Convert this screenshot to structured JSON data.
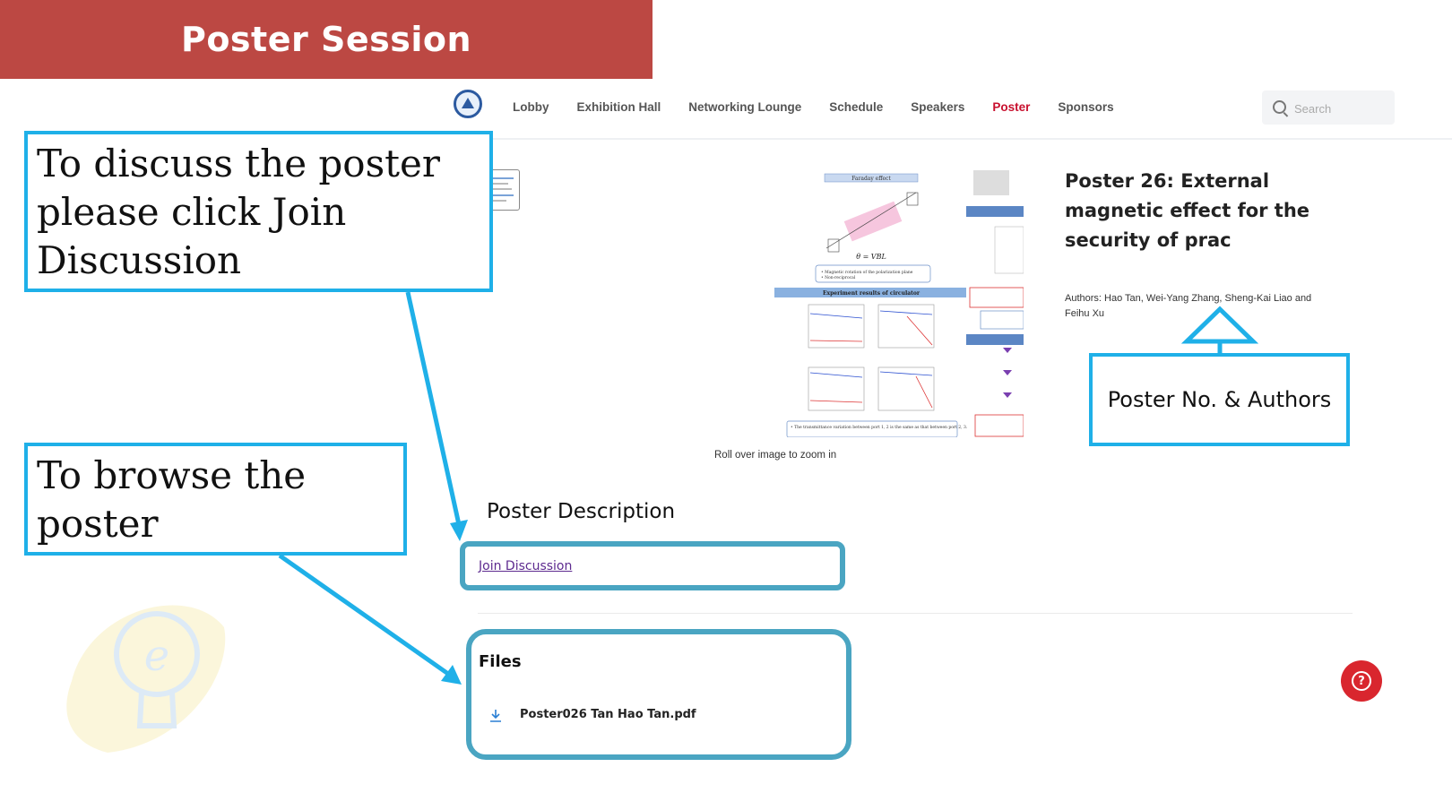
{
  "banner": {
    "title": "Poster Session"
  },
  "nav": {
    "items": [
      {
        "label": "Lobby",
        "active": false
      },
      {
        "label": "Exhibition Hall",
        "active": false
      },
      {
        "label": "Networking Lounge",
        "active": false
      },
      {
        "label": "Schedule",
        "active": false
      },
      {
        "label": "Speakers",
        "active": false
      },
      {
        "label": "Poster",
        "active": true
      },
      {
        "label": "Sponsors",
        "active": false
      }
    ],
    "search_placeholder": "Search",
    "active_color": "#c8102e"
  },
  "poster": {
    "zoom_hint": "Roll over image to zoom in",
    "title": "Poster 26: External magnetic effect for the security of prac",
    "authors": "Authors: Hao Tan, Wei-Yang Zhang, Sheng-Kai Liao and Feihu Xu",
    "image_text": {
      "faraday_heading": "Faraday effect",
      "equation": "θ = VBL",
      "bullets": "• Magnetic rotation of the polarization plane\n• Non-reciprocal",
      "results_heading": "Experiment results of circulator",
      "caption": "• The transmittance variation between port 1, 2 is the same as that between port 2, 3."
    }
  },
  "description": {
    "heading": "Poster Description",
    "join_link": "Join Discussion"
  },
  "files": {
    "heading": "Files",
    "items": [
      {
        "name": "Poster026 Tan Hao Tan.pdf"
      }
    ]
  },
  "help": {
    "glyph": "?"
  },
  "callouts": {
    "discuss": "To discuss the poster please click Join Discussion",
    "browse": "To browse the poster",
    "poster_no": "Poster No. & Authors"
  },
  "colors": {
    "banner": "#bc4843",
    "callout_border": "#1fb0e8",
    "highlight_border": "#4aa5c2",
    "help_button": "#d9262e"
  }
}
